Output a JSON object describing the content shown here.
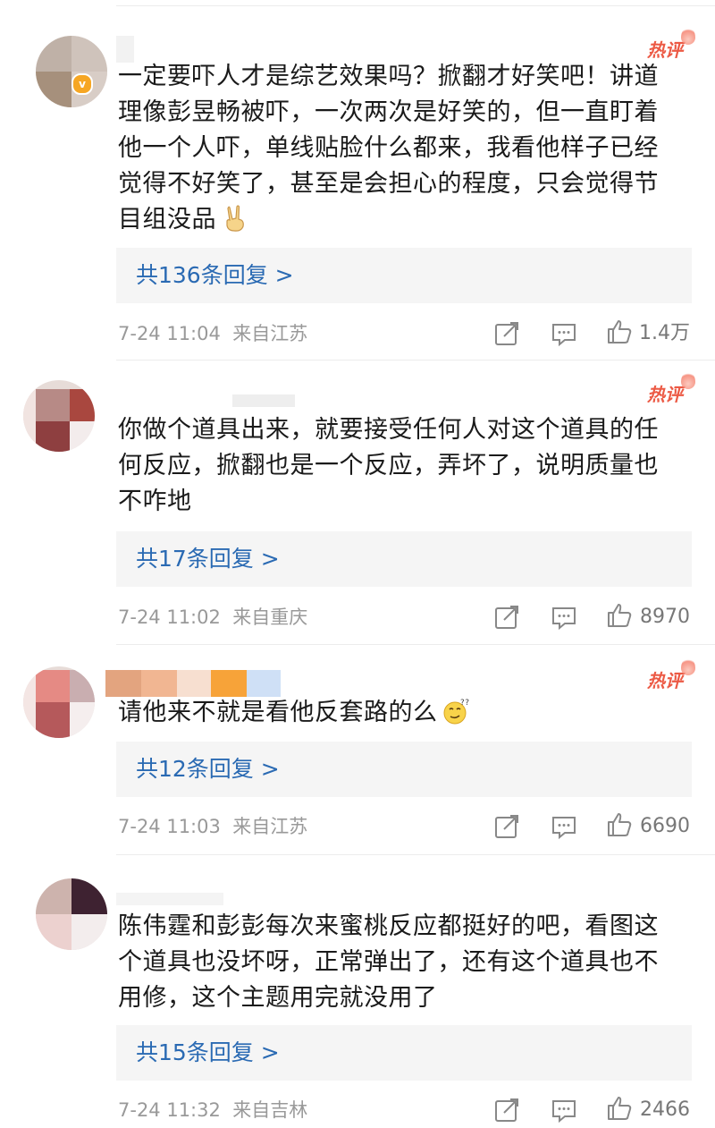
{
  "hot_label": "热评",
  "colors": {
    "link_blue": "#2a6ab3",
    "hot_red": "#ec5a45",
    "meta_gray": "#999999",
    "reply_bg": "#f5f5f5"
  },
  "comments": [
    {
      "text": "一定要吓人才是综艺效果吗？掀翻才好笑吧！讲道理像彭昱畅被吓，一次两次是好笑的，但一直盯着他一个人吓，单线贴脸什么都来，我看他样子已经觉得不好笑了，甚至是会担心的程度，只会觉得节目组没品",
      "emoji": "victory-hand-emoji",
      "reply_label": "共136条回复 >",
      "time": "7-24 11:04",
      "location": "来自江苏",
      "likes": "1.4万",
      "verified": true
    },
    {
      "text": "你做个道具出来，就要接受任何人对这个道具的任何反应，掀翻也是一个反应，弄坏了，说明质量也不咋地",
      "emoji": "",
      "reply_label": "共17条回复 >",
      "time": "7-24 11:02",
      "location": "来自重庆",
      "likes": "8970",
      "verified": false
    },
    {
      "text": "请他来不就是看他反套路的么",
      "emoji": "thinking-face-emoji",
      "reply_label": "共12条回复 >",
      "time": "7-24 11:03",
      "location": "来自江苏",
      "likes": "6690",
      "verified": false
    },
    {
      "text": "陈伟霆和彭彭每次来蜜桃反应都挺好的吧，看图这个道具也没坏呀，正常弹出了，还有这个道具也不用修，这个主题用完就没用了",
      "emoji": "",
      "reply_label": "共15条回复 >",
      "time": "7-24 11:32",
      "location": "来自吉林",
      "likes": "2466",
      "verified": false
    }
  ],
  "icons": {
    "share": "share-icon",
    "comment": "comment-icon",
    "like": "like-icon"
  }
}
